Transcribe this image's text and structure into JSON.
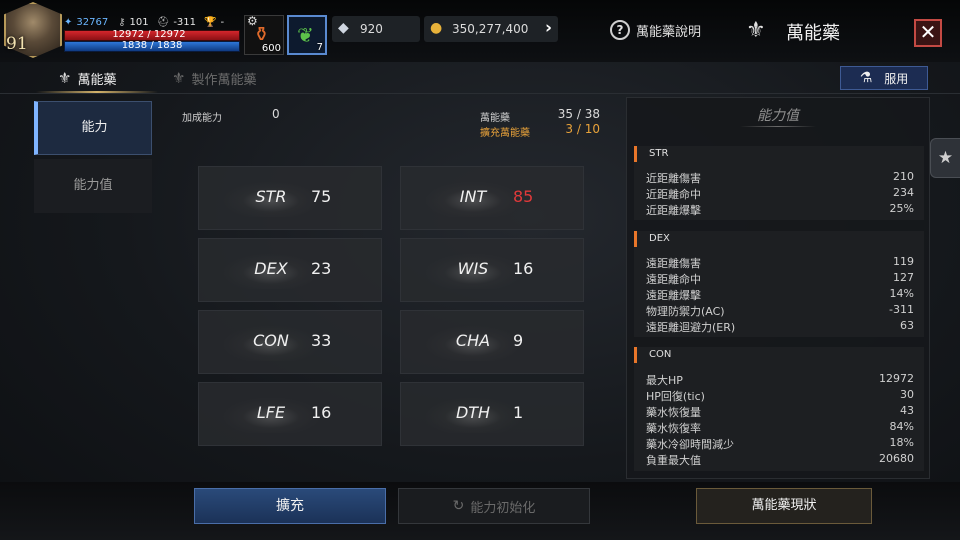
{
  "player": {
    "level": "91",
    "combat_power": "32767",
    "lawful": "101",
    "defense": "-311",
    "trophy": "-",
    "hp_text": "12972 / 12972",
    "mp_text": "1838 / 1838"
  },
  "items": {
    "potion_count": "600",
    "herb_count": "7"
  },
  "currency": {
    "crystal": "920",
    "gold": "350,277,400"
  },
  "header": {
    "help_label": "萬能藥說明",
    "title": "萬能藥",
    "close_glyph": "✕"
  },
  "tabs": {
    "elixir": "萬能藥",
    "craft": "製作萬能藥"
  },
  "use_button": "服用",
  "nav": {
    "ability": "能力",
    "stats": "能力值"
  },
  "summary": {
    "bonus_label": "加成能力",
    "bonus_value": "0",
    "elixir_label": "萬能藥",
    "elixir_value": "35 / 38",
    "expand_label": "擴充萬能藥",
    "expand_value": "3 / 10"
  },
  "stat_cards": [
    {
      "name": "STR",
      "value": "75"
    },
    {
      "name": "INT",
      "value": "85"
    },
    {
      "name": "DEX",
      "value": "23"
    },
    {
      "name": "WIS",
      "value": "16"
    },
    {
      "name": "CON",
      "value": "33"
    },
    {
      "name": "CHA",
      "value": "9"
    },
    {
      "name": "LFE",
      "value": "16"
    },
    {
      "name": "DTH",
      "value": "1"
    }
  ],
  "right_panel": {
    "title": "能力值",
    "sections": [
      {
        "head": "STR",
        "rows": [
          {
            "label": "近距離傷害",
            "value": "210"
          },
          {
            "label": "近距離命中",
            "value": "234"
          },
          {
            "label": "近距離爆擊",
            "value": "25%"
          }
        ]
      },
      {
        "head": "DEX",
        "rows": [
          {
            "label": "遠距離傷害",
            "value": "119"
          },
          {
            "label": "遠距離命中",
            "value": "127"
          },
          {
            "label": "遠距離爆擊",
            "value": "14%"
          },
          {
            "label": "物理防禦力(AC)",
            "value": "-311"
          },
          {
            "label": "遠距離迴避力(ER)",
            "value": "63"
          }
        ]
      },
      {
        "head": "CON",
        "rows": [
          {
            "label": "最大HP",
            "value": "12972"
          },
          {
            "label": "HP回復(tic)",
            "value": "30"
          },
          {
            "label": "藥水恢復量",
            "value": "43"
          },
          {
            "label": "藥水恢復率",
            "value": "84%"
          },
          {
            "label": "藥水冷卻時間減少",
            "value": "18%"
          },
          {
            "label": "負重最大值",
            "value": "20680"
          }
        ]
      }
    ]
  },
  "buttons": {
    "expand": "擴充",
    "reset": "能力初始化",
    "status": "萬能藥現狀"
  },
  "colors": {
    "accent_blue": "#7fb4ff",
    "highlight_red": "#e0393a",
    "expand_orange": "#e8a23a",
    "section_marker": "#e8762a"
  }
}
